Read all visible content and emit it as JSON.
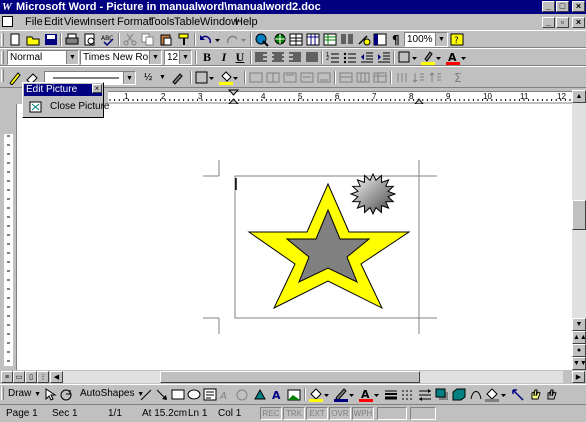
{
  "window": {
    "title": "Microsoft Word - Picture in manualword\\manualword2.doc",
    "logo_letter": "W",
    "minimize": "_",
    "maximize": "□",
    "close": "×"
  },
  "menu": {
    "items": [
      "File",
      "Edit",
      "View",
      "Insert",
      "Format",
      "Tools",
      "Table",
      "Window",
      "Help"
    ],
    "doc_controls": {
      "minimize": "_",
      "restore": "▫",
      "close": "×"
    }
  },
  "standard_toolbar": {
    "zoom": "100%"
  },
  "formatting_toolbar": {
    "style": "Normal",
    "font": "Times New Roman",
    "size": "12",
    "bold": "B",
    "italic": "I",
    "underline": "U"
  },
  "drawing_toolbar_top": {
    "line_weight": "½"
  },
  "edit_picture": {
    "title": "Edit Picture",
    "close_button": "×",
    "close_label": "Close Picture"
  },
  "ruler": {
    "numbers": [
      "1",
      "2",
      "3",
      "4",
      "5",
      "6",
      "7",
      "8",
      "9",
      "10",
      "11",
      "12"
    ]
  },
  "drawing_toolbar": {
    "draw_label": "Draw",
    "autoshapes_label": "AutoShapes"
  },
  "status": {
    "page": "Page 1",
    "sec": "Sec 1",
    "pages": "1/1",
    "at": "At 15.2cm",
    "ln": "Ln 1",
    "col": "Col 1",
    "modes": [
      "REC",
      "TRK",
      "EXT",
      "OVR",
      "WPH"
    ]
  },
  "colors": {
    "titlebar": "#000080",
    "star_outer": "#ffff00",
    "star_inner": "#808080",
    "face": "#c0c0c0"
  }
}
